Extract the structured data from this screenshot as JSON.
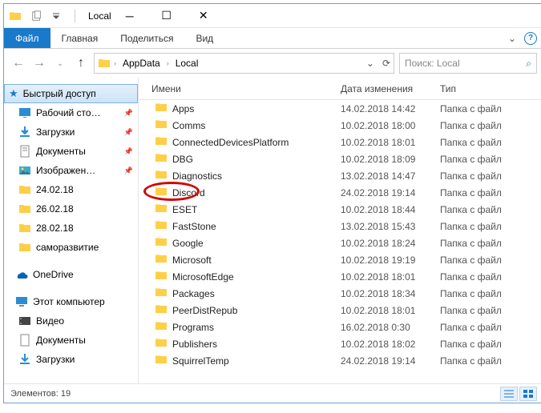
{
  "title": "Local",
  "ribbon": {
    "file": "Файл",
    "home": "Главная",
    "share": "Поделиться",
    "view": "Вид"
  },
  "breadcrumb": {
    "parts": [
      "AppData",
      "Local"
    ]
  },
  "search": {
    "placeholder": "Поиск: Local"
  },
  "sidebar": {
    "quick_access": "Быстрый доступ",
    "desktop": "Рабочий сто…",
    "downloads": "Загрузки",
    "documents": "Документы",
    "pictures": "Изображен…",
    "f1": "24.02.18",
    "f2": "26.02.18",
    "f3": "28.02.18",
    "f4": "саморазвитие",
    "onedrive": "OneDrive",
    "this_pc": "Этот компьютер",
    "videos": "Видео",
    "documents2": "Документы",
    "downloads2": "Загрузки"
  },
  "columns": {
    "name": "Имени",
    "date": "Дата изменения",
    "type": "Тип"
  },
  "type_folder": "Папка с файл",
  "files": [
    {
      "name": "Apps",
      "date": "14.02.2018 14:42"
    },
    {
      "name": "Comms",
      "date": "10.02.2018 18:00"
    },
    {
      "name": "ConnectedDevicesPlatform",
      "date": "10.02.2018 18:01"
    },
    {
      "name": "DBG",
      "date": "10.02.2018 18:09"
    },
    {
      "name": "Diagnostics",
      "date": "13.02.2018 14:47"
    },
    {
      "name": "Discord",
      "date": "24.02.2018 19:14",
      "circled": true
    },
    {
      "name": "ESET",
      "date": "10.02.2018 18:44"
    },
    {
      "name": "FastStone",
      "date": "13.02.2018 15:43"
    },
    {
      "name": "Google",
      "date": "10.02.2018 18:24"
    },
    {
      "name": "Microsoft",
      "date": "10.02.2018 19:19"
    },
    {
      "name": "MicrosoftEdge",
      "date": "10.02.2018 18:01"
    },
    {
      "name": "Packages",
      "date": "10.02.2018 18:34"
    },
    {
      "name": "PeerDistRepub",
      "date": "10.02.2018 18:01"
    },
    {
      "name": "Programs",
      "date": "16.02.2018 0:30"
    },
    {
      "name": "Publishers",
      "date": "10.02.2018 18:02"
    },
    {
      "name": "SquirrelTemp",
      "date": "24.02.2018 19:14"
    }
  ],
  "status": {
    "count_label": "Элементов:",
    "count": "19"
  }
}
